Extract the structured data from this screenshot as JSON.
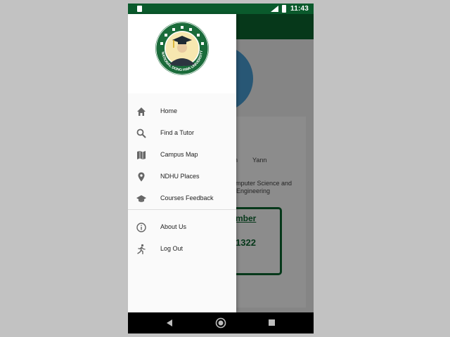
{
  "status_bar": {
    "time": "11:43",
    "left_icon": "sd-card-icon",
    "signal_icon": "cellular-signal-icon",
    "battery_icon": "battery-icon",
    "background_color": "#0a5a2c"
  },
  "background_app": {
    "toolbar_color": "#0b6631",
    "name_fragment": "n",
    "name_second": "Yann",
    "department_line1": "mputer Science and",
    "department_line2": "Engineering",
    "member_title": "mber",
    "member_number": "1322"
  },
  "drawer": {
    "logo": "national-dong-hwa-university-logo",
    "logo_text": "NATIONAL DONG HWA UNIVERSITY",
    "menu_items": [
      {
        "label": "Home",
        "icon": "home-icon"
      },
      {
        "label": "Find a Tutor",
        "icon": "search-icon"
      },
      {
        "label": "Campus Map",
        "icon": "map-icon"
      },
      {
        "label": "NDHU Places",
        "icon": "place-icon"
      },
      {
        "label": "Courses Feedback",
        "icon": "school-icon"
      }
    ],
    "secondary_items": [
      {
        "label": "About Us",
        "icon": "info-icon"
      },
      {
        "label": "Log Out",
        "icon": "run-icon"
      }
    ]
  },
  "nav_bar": {
    "back": "back-triangle-icon",
    "home": "home-circle-icon",
    "recents": "recents-square-icon"
  },
  "colors": {
    "brand_green": "#0b6631",
    "drawer_bg": "#fafafa",
    "icon_gray": "#666666"
  }
}
